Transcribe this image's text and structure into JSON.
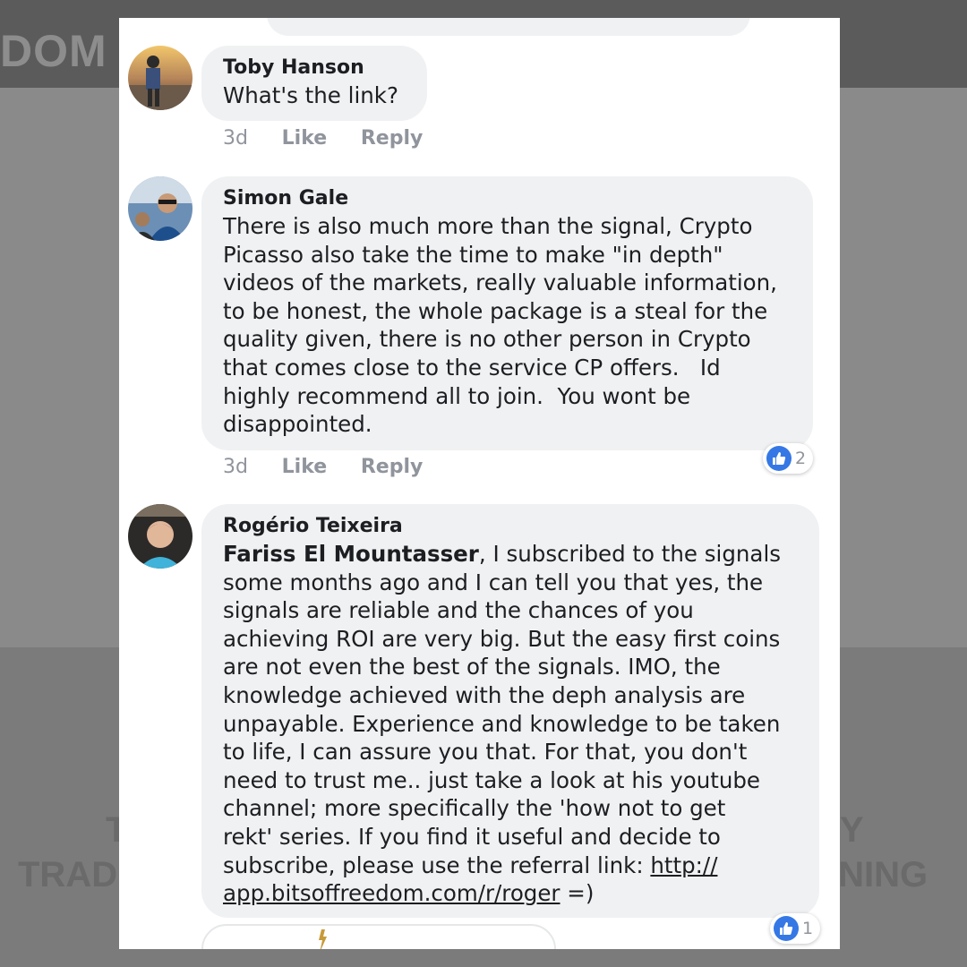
{
  "background": {
    "logo_text": "DOM",
    "line1_left": "T",
    "line1_right": "Y",
    "line2_left": "TRAD",
    "line2_right": "INING"
  },
  "comments": [
    {
      "author": "Toby Hanson",
      "text": "What's the link?",
      "time": "3d",
      "like_label": "Like",
      "reply_label": "Reply"
    },
    {
      "author": "Simon Gale",
      "text_lines": [
        "There is also much more than the signal, Crypto",
        "Picasso also take the time to make \"in depth\"",
        "videos of the markets, really valuable information,",
        "to be honest, the whole package is a steal for the",
        "quality given, there is no other person in Crypto",
        "that comes close to the service CP offers.   Id",
        "highly recommend all to join.  You wont be",
        "disappointed."
      ],
      "time": "3d",
      "like_label": "Like",
      "reply_label": "Reply",
      "reaction_count": "2"
    },
    {
      "author": "Rogério Teixeira",
      "mention": "Fariss El Mountasser",
      "first_line_rest": ", I subscribed to the signals",
      "text_lines": [
        "some months ago and I can tell you that yes, the",
        "signals are reliable and the chances of you",
        "achieving ROI are very big. But the easy first coins",
        "are not even the best of the signals. IMO, the",
        "knowledge achieved with the deph analysis are",
        "unpayable. Experience and knowledge to be taken",
        "to life, I can assure you that. For that, you don't",
        "need to trust me.. just take a look at his youtube",
        "channel; more specifically the 'how not to get",
        "rekt' series. If you find it useful and decide to"
      ],
      "link_line_prefix": "subscribe, please use the referral link: ",
      "link_part1": "http://",
      "link_part2": "app.bitsoffreedom.com/r/roger",
      "link_suffix": " =)",
      "reaction_count": "1"
    }
  ],
  "colors": {
    "bubble": "#f0f1f3",
    "meta": "#90949c",
    "like_blue": "#3578e5",
    "text": "#1c1e21"
  }
}
